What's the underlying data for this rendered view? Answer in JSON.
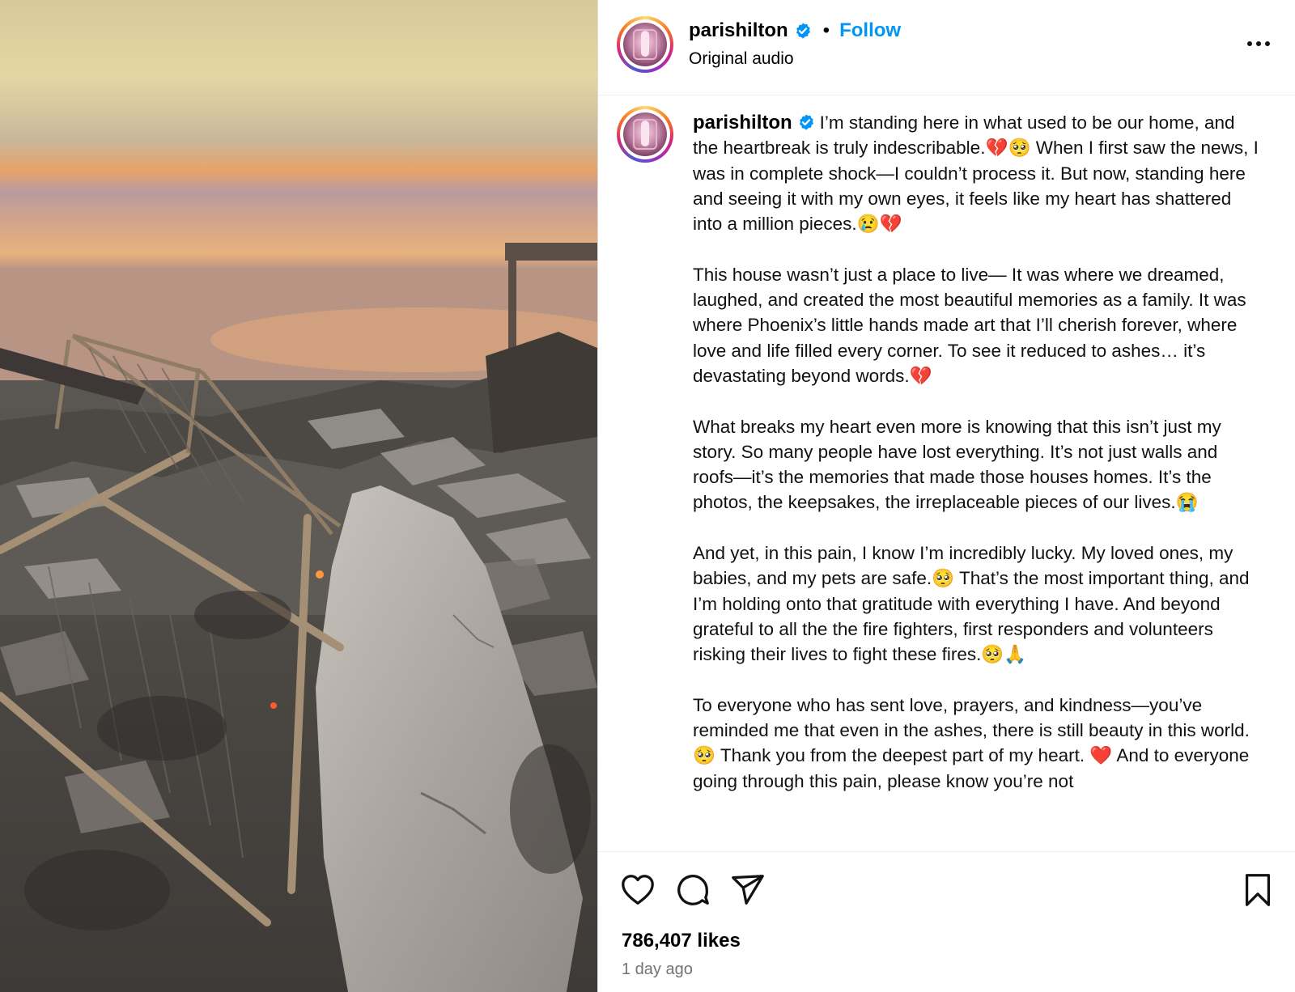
{
  "post": {
    "username": "parishilton",
    "follow_label": "Follow",
    "separator": "•",
    "audio": "Original audio",
    "more_label": "..."
  },
  "caption": {
    "username": "parishilton",
    "paragraphs": [
      "I’m standing here in what used to be our home, and the heartbreak is truly indescribable.💔🥺 When I first saw the news, I was in complete shock—I couldn’t process it. But now, standing here and seeing it with my own eyes, it feels like my heart has shattered into a million pieces.😢💔",
      "This house wasn’t just a place to live— It was where we dreamed, laughed, and created the most beautiful memories as a family. It was where Phoenix’s little hands made art that I’ll cherish forever, where love and life filled every corner. To see it reduced to ashes… it’s devastating beyond words.💔",
      "What breaks my heart even more is knowing that this isn’t just my story. So many people have lost everything. It’s not just walls and roofs—it’s the memories that made those houses homes. It’s the photos, the keepsakes, the irreplaceable pieces of our lives.😭",
      "And yet, in this pain, I know I’m incredibly lucky. My loved ones, my babies, and my pets are safe.🥺 That’s the most important thing, and I’m holding onto that gratitude with everything I have. And beyond grateful to all the the fire fighters, first responders and volunteers risking their lives to fight these fires.🥺🙏",
      "To everyone who has sent love, prayers, and kindness—you’ve reminded me that even in the ashes, there is still beauty in this world.🥺 Thank you from the deepest part of my heart. ❤️ And to everyone going through this pain, please know you’re not"
    ]
  },
  "engagement": {
    "likes": "786,407 likes",
    "timestamp": "1 day ago"
  },
  "icons": {
    "verified": "verified-badge-icon",
    "like": "heart-icon",
    "comment": "comment-icon",
    "share": "send-icon",
    "save": "bookmark-icon",
    "more": "more-options-icon"
  },
  "colors": {
    "accent": "#0095f6",
    "verified": "#0095f6",
    "muted": "#737373"
  }
}
